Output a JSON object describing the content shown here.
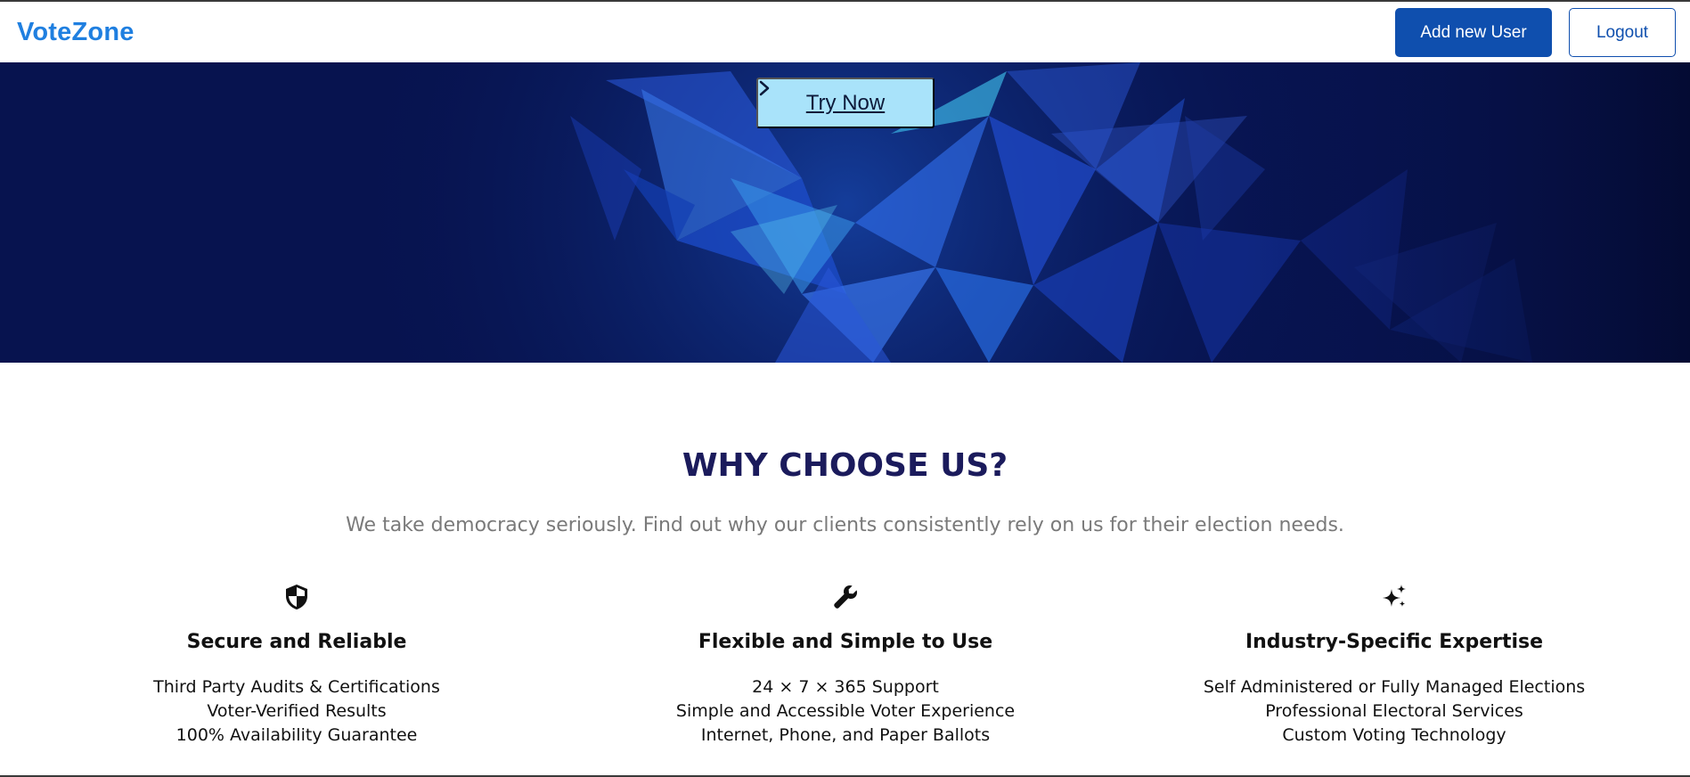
{
  "navbar": {
    "brand": "VoteZone",
    "add_user_label": "Add new User",
    "logout_label": "Logout"
  },
  "hero": {
    "cta_label": "Try Now"
  },
  "why": {
    "title": "WHY CHOOSE US?",
    "subtitle": "We take democracy seriously. Find out why our clients consistently rely on us for their election needs.",
    "features": [
      {
        "icon": "shield-icon",
        "title": "Secure and Reliable",
        "items": [
          "Third Party Audits & Certifications",
          "Voter-Verified Results",
          "100% Availability Guarantee"
        ]
      },
      {
        "icon": "wrench-icon",
        "title": "Flexible and Simple to Use",
        "items": [
          "24 × 7 × 365 Support",
          "Simple and Accessible Voter Experience",
          "Internet, Phone, and Paper Ballots"
        ]
      },
      {
        "icon": "sparkles-icon",
        "title": "Industry-Specific Expertise",
        "items": [
          "Self Administered or Fully Managed Elections",
          "Professional Electoral Services",
          "Custom Voting Technology"
        ]
      }
    ]
  },
  "colors": {
    "brand": "#1f7fe0",
    "primary_button": "#0f4fae",
    "hero_bg": "#07134f",
    "cta_bg": "#a9e3fa",
    "title": "#1b1b5c",
    "subtitle": "#7a7a7a"
  }
}
